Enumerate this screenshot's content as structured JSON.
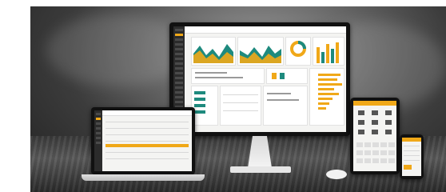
{
  "scene": {
    "description_tags": [
      "monitor",
      "laptop",
      "tablet",
      "phone",
      "mouse"
    ],
    "accent_color": "#f0a818",
    "chart_color_teal": "#1e8a7e",
    "sidebar_color": "#2b2b2b"
  }
}
